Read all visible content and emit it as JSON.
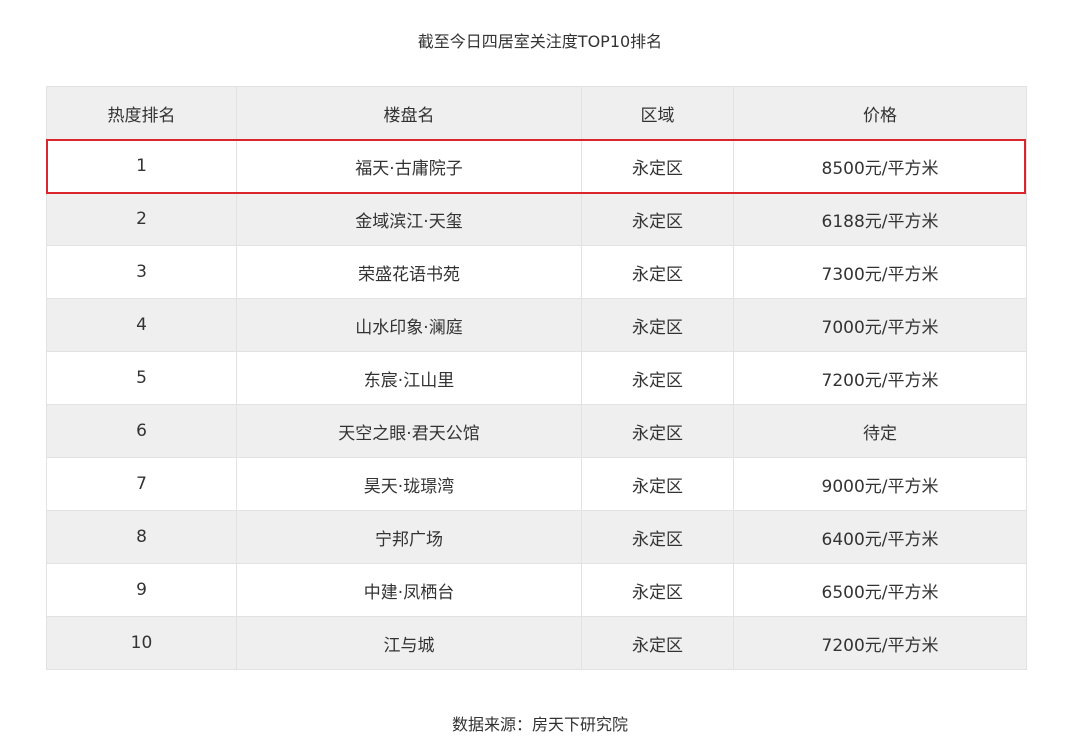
{
  "title": "截至今日四居室关注度TOP10排名",
  "table": {
    "headers": [
      "热度排名",
      "楼盘名",
      "区域",
      "价格"
    ],
    "rows": [
      {
        "rank": "1",
        "name": "福天·古庸院子",
        "district": "永定区",
        "price": "8500元/平方米"
      },
      {
        "rank": "2",
        "name": "金域滨江·天玺",
        "district": "永定区",
        "price": "6188元/平方米"
      },
      {
        "rank": "3",
        "name": "荣盛花语书苑",
        "district": "永定区",
        "price": "7300元/平方米"
      },
      {
        "rank": "4",
        "name": "山水印象·澜庭",
        "district": "永定区",
        "price": "7000元/平方米"
      },
      {
        "rank": "5",
        "name": "东宸·江山里",
        "district": "永定区",
        "price": "7200元/平方米"
      },
      {
        "rank": "6",
        "name": "天空之眼·君天公馆",
        "district": "永定区",
        "price": "待定"
      },
      {
        "rank": "7",
        "name": "昊天·珑璟湾",
        "district": "永定区",
        "price": "9000元/平方米"
      },
      {
        "rank": "8",
        "name": "宁邦广场",
        "district": "永定区",
        "price": "6400元/平方米"
      },
      {
        "rank": "9",
        "name": "中建·凤栖台",
        "district": "永定区",
        "price": "6500元/平方米"
      },
      {
        "rank": "10",
        "name": "江与城",
        "district": "永定区",
        "price": "7200元/平方米"
      }
    ]
  },
  "source": "数据来源：房天下研究院",
  "colors": {
    "header_bg": "#efefef",
    "alt_row_bg": "#efefef",
    "highlight_border": "#d9262c"
  }
}
